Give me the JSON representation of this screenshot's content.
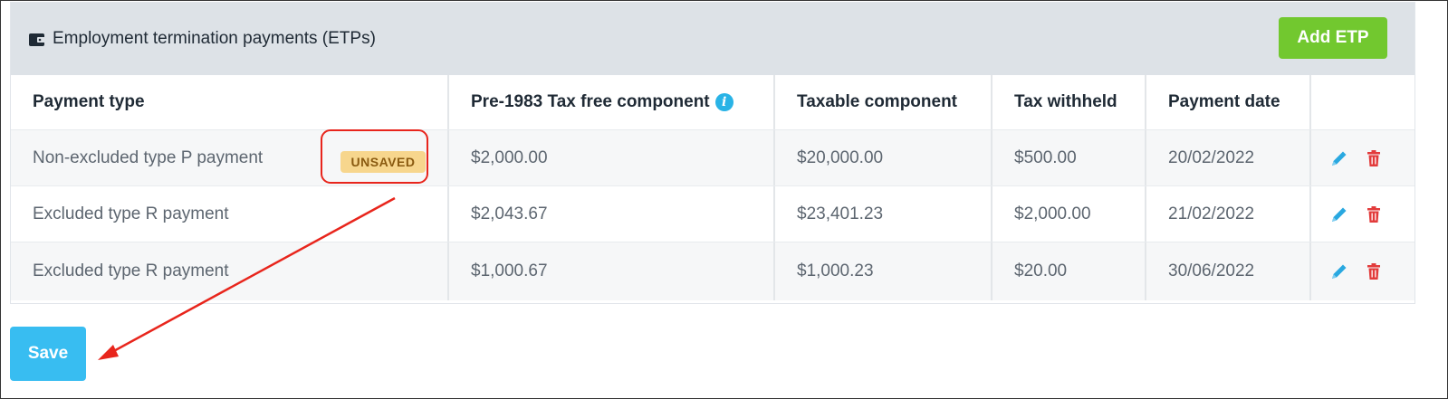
{
  "panel": {
    "title": "Employment termination payments (ETPs)",
    "add_button": "Add ETP"
  },
  "table": {
    "headers": [
      "Payment type",
      "Pre-1983 Tax free component",
      "Taxable component",
      "Tax withheld",
      "Payment date"
    ],
    "rows": [
      {
        "payment_type": "Non-excluded type P payment",
        "pre1983": "$2,000.00",
        "taxable": "$20,000.00",
        "withheld": "$500.00",
        "date": "20/02/2022",
        "badge": "UNSAVED"
      },
      {
        "payment_type": "Excluded type R payment",
        "pre1983": "$2,043.67",
        "taxable": "$23,401.23",
        "withheld": "$2,000.00",
        "date": "21/02/2022"
      },
      {
        "payment_type": "Excluded type R payment",
        "pre1983": "$1,000.67",
        "taxable": "$1,000.23",
        "withheld": "$20.00",
        "date": "30/06/2022"
      }
    ]
  },
  "save_button": "Save",
  "icons": {
    "wallet": "wallet-icon",
    "info": "info-icon",
    "edit": "pencil-icon",
    "delete": "trash-icon"
  },
  "colors": {
    "add_button": "#72c82f",
    "save_button": "#38bdf1",
    "info_icon": "#29b3e6",
    "edit_icon": "#29a8e0",
    "delete_icon": "#e23b3b",
    "badge_bg": "#f7d68d",
    "annotation": "#e8251c"
  }
}
